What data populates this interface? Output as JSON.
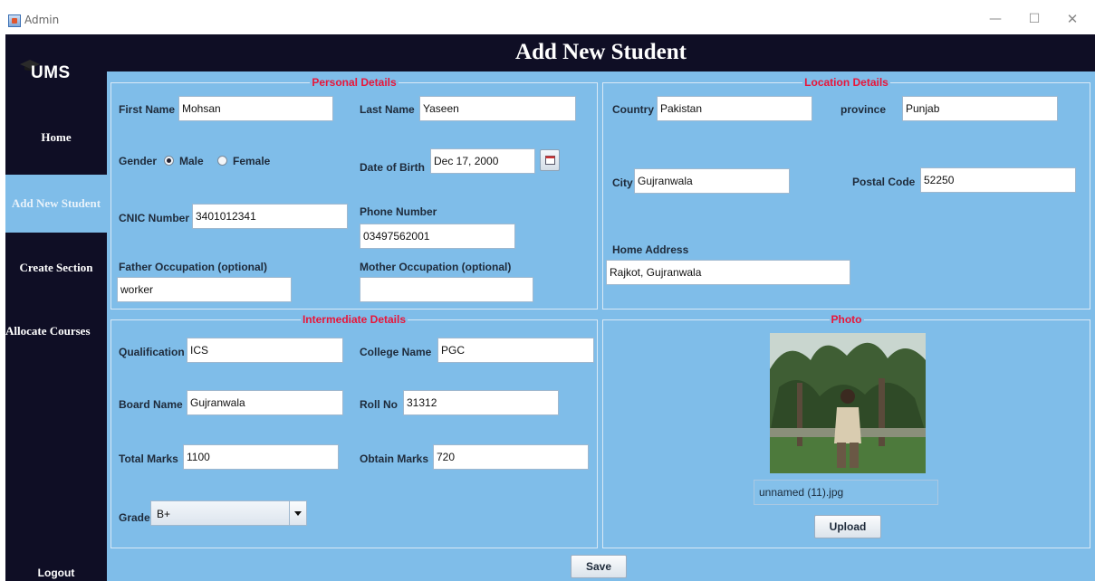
{
  "window": {
    "title": "Admin",
    "minimize": "—",
    "maximize": "☐",
    "close": "✕"
  },
  "sidebar": {
    "logo": "UMS",
    "items": [
      {
        "label": "Home"
      },
      {
        "label": "Add New Student"
      },
      {
        "label": "Create Section"
      },
      {
        "label": "Allocate Courses"
      }
    ],
    "logout": "Logout",
    "active_color": "#7fbde9"
  },
  "header": {
    "title": "Add New Student"
  },
  "personal": {
    "title": "Personal Details",
    "first_name_label": "First Name",
    "first_name": "Mohsan",
    "last_name_label": "Last Name",
    "last_name": "Yaseen",
    "gender_label": "Gender",
    "gender_male": "Male",
    "gender_female": "Female",
    "gender_selected": "Male",
    "dob_label": "Date of Birth",
    "dob": "Dec 17, 2000",
    "cnic_label": "CNIC Number",
    "cnic": "3401012341",
    "phone_label": "Phone Number",
    "phone": "03497562001",
    "father_label": "Father Occupation (optional)",
    "father": "worker",
    "mother_label": "Mother Occupation (optional)",
    "mother": ""
  },
  "location": {
    "title": "Location Details",
    "country_label": "Country",
    "country": "Pakistan",
    "province_label": "province",
    "province": "Punjab",
    "city_label": "City",
    "city": "Gujranwala",
    "postal_label": "Postal Code",
    "postal": "52250",
    "address_label": "Home Address",
    "address": "Rajkot, Gujranwala"
  },
  "intermediate": {
    "title": "Intermediate Details",
    "qualification_label": "Qualification",
    "qualification": "ICS",
    "college_label": "College Name",
    "college": "PGC",
    "board_label": "Board Name",
    "board": "Gujranwala",
    "roll_label": "Roll No",
    "roll": "31312",
    "total_label": "Total Marks",
    "total": "1100",
    "obtain_label": "Obtain Marks",
    "obtain": "720",
    "grade_label": "Grade",
    "grade": "B+"
  },
  "photo": {
    "title": "Photo",
    "filename": "unnamed (11).jpg",
    "upload_label": "Upload"
  },
  "actions": {
    "save_label": "Save"
  },
  "colors": {
    "sidebar_bg": "#0f0e25",
    "content_bg": "#7fbde9",
    "section_title": "#e8163a"
  }
}
